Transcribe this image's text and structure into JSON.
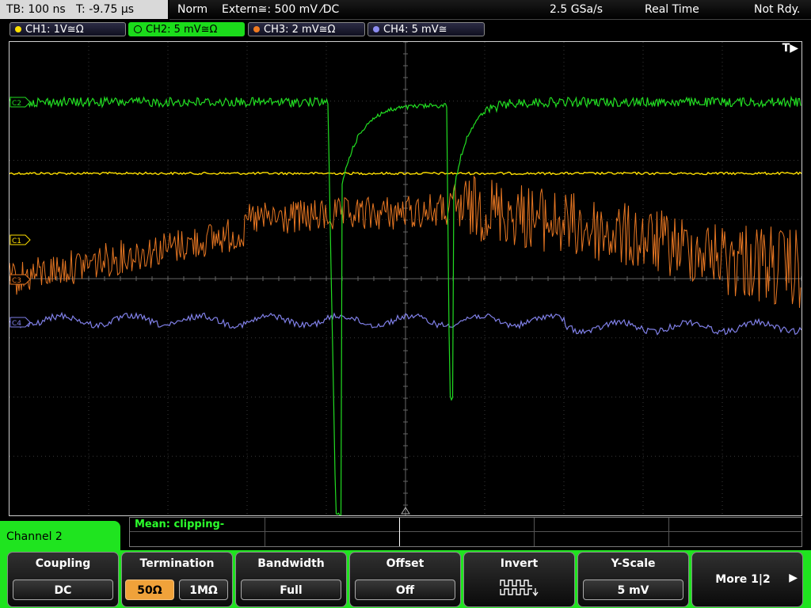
{
  "status": {
    "timebase": "TB: 100 ns",
    "trigger_time": "T: -9.75 µs",
    "mode": "Norm",
    "trigger_source": "Extern≅: 500 mV ⁄DC",
    "sample_rate": "2.5 GSa/s",
    "acquisition": "Real Time",
    "ready_state": "Not Rdy."
  },
  "channels": [
    {
      "label": "CH1: 1V≅Ω",
      "color": "#ffe000"
    },
    {
      "label": "CH2: 5 mV≅Ω",
      "color": "#22dd22"
    },
    {
      "label": "CH3: 2 mV≅Ω",
      "color": "#f07a20"
    },
    {
      "label": "CH4: 5 mV≅",
      "color": "#8c8cf0"
    }
  ],
  "screen": {
    "trigger_marker": "T▶",
    "markers": [
      "C2",
      "C1",
      "C3",
      "C4"
    ]
  },
  "measurement": {
    "text": "Mean: clipping-"
  },
  "menu": {
    "title": "Channel 2",
    "coupling": {
      "title": "Coupling",
      "value": "DC"
    },
    "termination": {
      "title": "Termination",
      "option_a": "50Ω",
      "option_b": "1MΩ"
    },
    "bandwidth": {
      "title": "Bandwidth",
      "value": "Full"
    },
    "offset": {
      "title": "Offset",
      "value": "Off"
    },
    "invert": {
      "title": "Invert",
      "icon": "invert-waveform-icon"
    },
    "yscale": {
      "title": "Y-Scale",
      "value": "5 mV"
    },
    "more": {
      "label": "More 1|2"
    }
  }
}
